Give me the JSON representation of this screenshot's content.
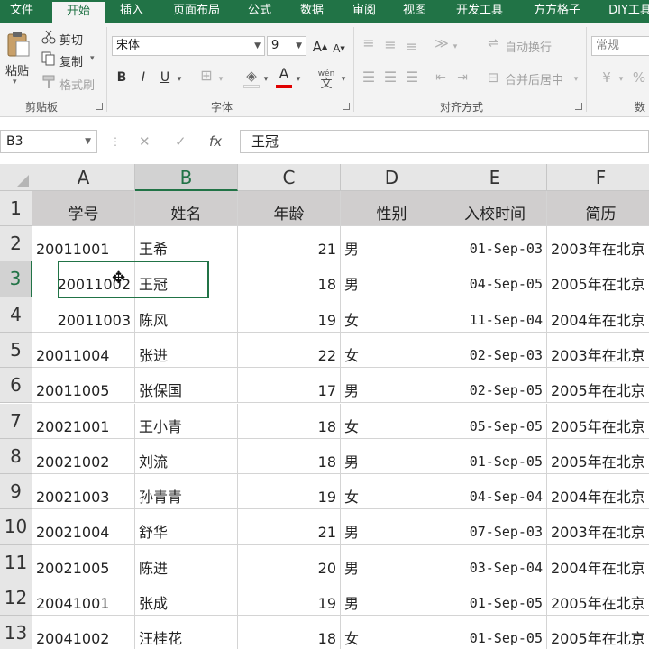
{
  "tabs": [
    {
      "label": "文件",
      "active": false
    },
    {
      "label": "开始",
      "active": true
    },
    {
      "label": "插入",
      "active": false
    },
    {
      "label": "页面布局",
      "active": false
    },
    {
      "label": "公式",
      "active": false
    },
    {
      "label": "数据",
      "active": false
    },
    {
      "label": "审阅",
      "active": false
    },
    {
      "label": "视图",
      "active": false
    },
    {
      "label": "开发工具",
      "active": false
    },
    {
      "label": "方方格子",
      "active": false
    },
    {
      "label": "DIY工具",
      "active": false
    }
  ],
  "clipboard": {
    "paste": "粘贴",
    "cut": "剪切",
    "copy": "复制",
    "format_painter": "格式刷",
    "group": "剪贴板"
  },
  "font": {
    "name": "宋体",
    "size": "9",
    "bold": "B",
    "italic": "I",
    "underline": "U",
    "font_color_letter": "A",
    "phonetic": "wén",
    "group": "字体"
  },
  "alignment": {
    "wrap": "自动换行",
    "merge": "合并后居中",
    "group": "对齐方式"
  },
  "number": {
    "format": "常规",
    "group": "数"
  },
  "formula_bar": {
    "cell_ref": "B3",
    "cancel": "✕",
    "confirm": "✓",
    "fx": "fx",
    "content": "王冠"
  },
  "sheet": {
    "columns": [
      "A",
      "B",
      "C",
      "D",
      "E",
      "F"
    ],
    "header_row": [
      "学号",
      "姓名",
      "年龄",
      "性别",
      "入校时间",
      "简历"
    ],
    "rows": [
      {
        "num": "2",
        "id": "20011001",
        "name": "王希",
        "age": "21",
        "sex": "男",
        "date": "01-Sep-03",
        "resume": "2003年在北京"
      },
      {
        "num": "3",
        "id": "20011002",
        "name": "王冠",
        "age": "18",
        "sex": "男",
        "date": "04-Sep-05",
        "resume": "2005年在北京"
      },
      {
        "num": "4",
        "id": "20011003",
        "name": "陈风",
        "age": "19",
        "sex": "女",
        "date": "11-Sep-04",
        "resume": "2004年在北京"
      },
      {
        "num": "5",
        "id": "20011004",
        "name": "张进",
        "age": "22",
        "sex": "女",
        "date": "02-Sep-03",
        "resume": "2003年在北京"
      },
      {
        "num": "6",
        "id": "20011005",
        "name": "张保国",
        "age": "17",
        "sex": "男",
        "date": "02-Sep-05",
        "resume": "2005年在北京"
      },
      {
        "num": "7",
        "id": "20021001",
        "name": "王小青",
        "age": "18",
        "sex": "女",
        "date": "05-Sep-05",
        "resume": "2005年在北京"
      },
      {
        "num": "8",
        "id": "20021002",
        "name": "刘流",
        "age": "18",
        "sex": "男",
        "date": "01-Sep-05",
        "resume": "2005年在北京"
      },
      {
        "num": "9",
        "id": "20021003",
        "name": "孙青青",
        "age": "19",
        "sex": "女",
        "date": "04-Sep-04",
        "resume": "2004年在北京"
      },
      {
        "num": "10",
        "id": "20021004",
        "name": "舒华",
        "age": "21",
        "sex": "男",
        "date": "07-Sep-03",
        "resume": "2003年在北京"
      },
      {
        "num": "11",
        "id": "20021005",
        "name": "陈进",
        "age": "20",
        "sex": "男",
        "date": "03-Sep-04",
        "resume": "2004年在北京"
      },
      {
        "num": "12",
        "id": "20041001",
        "name": "张成",
        "age": "19",
        "sex": "男",
        "date": "01-Sep-05",
        "resume": "2005年在北京"
      },
      {
        "num": "13",
        "id": "20041002",
        "name": "汪桂花",
        "age": "18",
        "sex": "女",
        "date": "01-Sep-05",
        "resume": "2005年在北京"
      }
    ]
  },
  "colors": {
    "excel_green": "#217346",
    "header_fill": "#d0cece"
  }
}
